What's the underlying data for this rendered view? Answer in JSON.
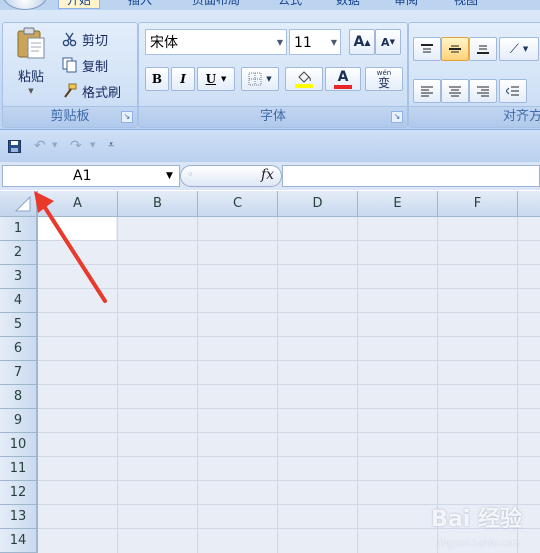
{
  "tabs": [
    "开始",
    "插入",
    "页面布局",
    "公式",
    "数据",
    "审阅",
    "视图"
  ],
  "ribbon": {
    "clipboard": {
      "paste_label": "粘贴",
      "cut_label": "剪切",
      "copy_label": "复制",
      "format_painter_label": "格式刷",
      "group_label": "剪贴板"
    },
    "font": {
      "font_name": "宋体",
      "font_size": "11",
      "grow_label": "A",
      "shrink_label": "A",
      "bold_label": "B",
      "italic_label": "I",
      "underline_label": "U",
      "font_color_label": "A",
      "phonetic_label": "wén",
      "phonetic_char": "变",
      "group_label": "字体"
    },
    "alignment": {
      "group_label": "对齐方"
    }
  },
  "formula_bar": {
    "name_box": "A1",
    "fx_label": "fx",
    "content": ""
  },
  "sheet": {
    "columns": [
      "A",
      "B",
      "C",
      "D",
      "E",
      "F"
    ],
    "rows": [
      "1",
      "2",
      "3",
      "4",
      "5",
      "6",
      "7",
      "8",
      "9",
      "10",
      "11",
      "12",
      "13",
      "14"
    ],
    "selected_cell": "A1"
  },
  "annotation": {
    "arrow_color": "#e8392b"
  },
  "watermark": {
    "text": "Bai 经验",
    "subtext": "jingyan.baidu.com"
  },
  "colors": {
    "fill_highlight": "#ffff00",
    "font_color": "#e8262a",
    "accent": "#ffd27a"
  }
}
